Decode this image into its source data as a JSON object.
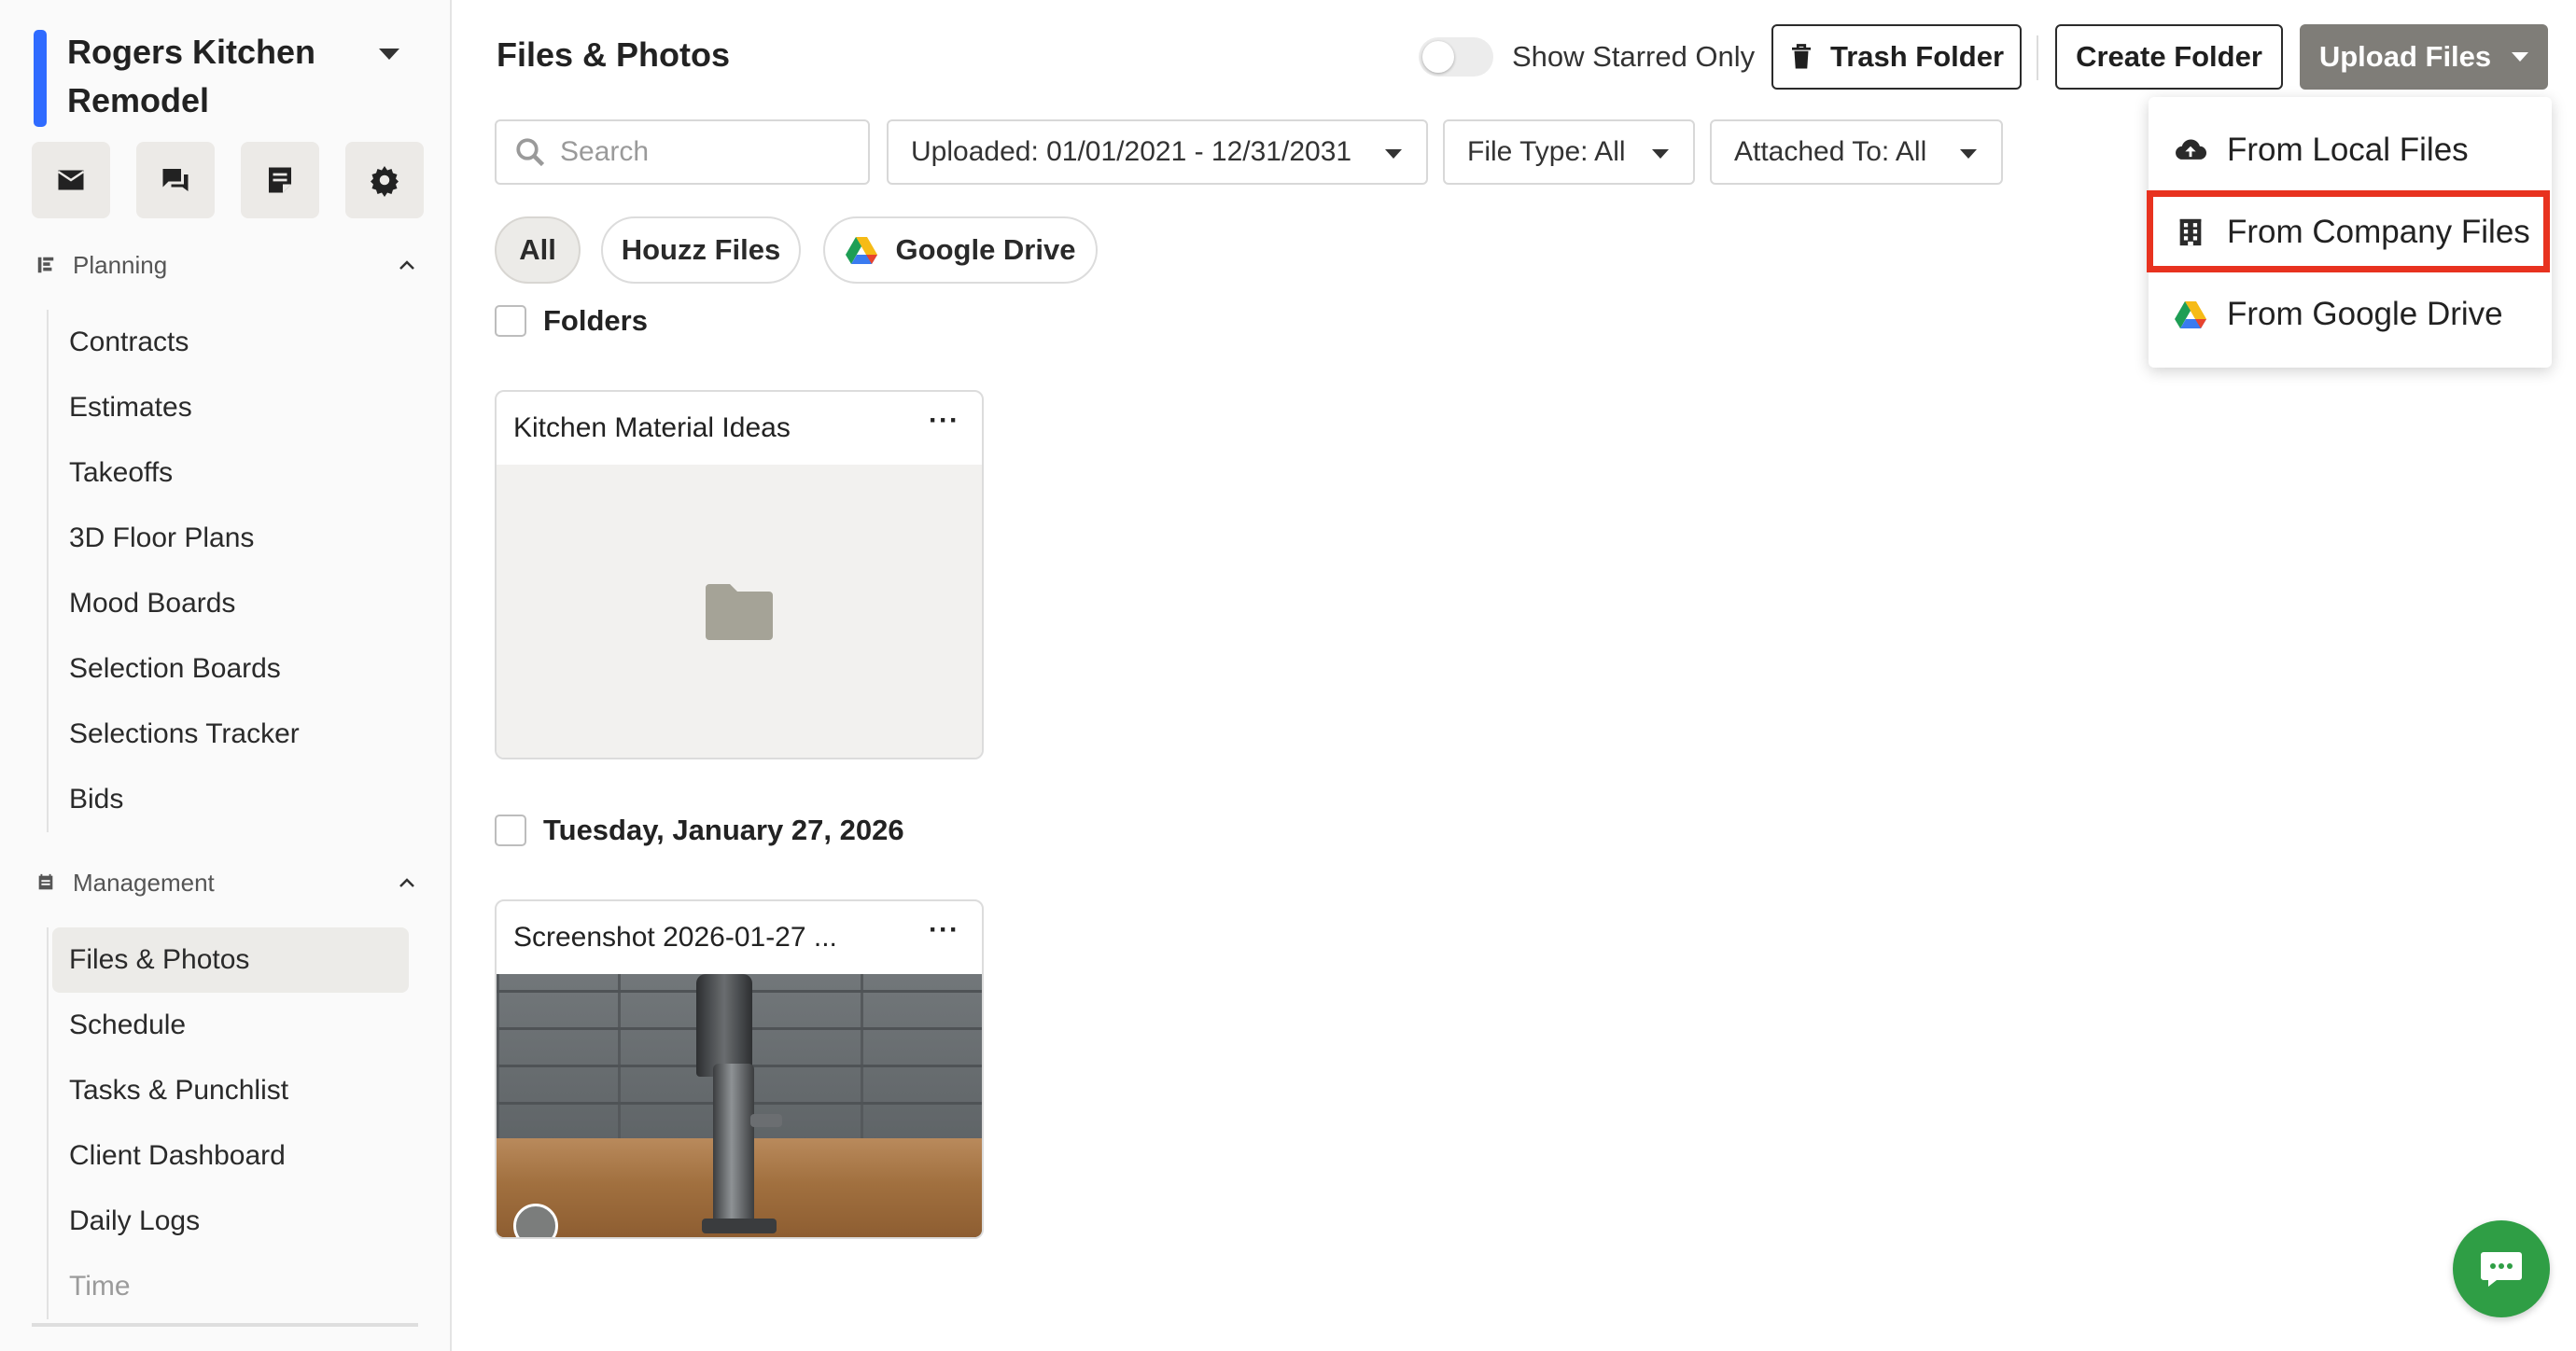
{
  "project": {
    "name": "Rogers Kitchen Remodel",
    "accent_color": "#2f6bff"
  },
  "quick_actions": [
    {
      "icon": "mail-icon"
    },
    {
      "icon": "chat-bubbles-icon"
    },
    {
      "icon": "notes-icon"
    },
    {
      "icon": "gear-icon"
    }
  ],
  "sidebar": {
    "planning": {
      "label": "Planning",
      "items": [
        "Contracts",
        "Estimates",
        "Takeoffs",
        "3D Floor Plans",
        "Mood Boards",
        "Selection Boards",
        "Selections Tracker",
        "Bids"
      ]
    },
    "management": {
      "label": "Management",
      "items": [
        "Files & Photos",
        "Schedule",
        "Tasks & Punchlist",
        "Client Dashboard",
        "Daily Logs",
        "Time"
      ],
      "active": "Files & Photos"
    }
  },
  "header": {
    "title": "Files & Photos",
    "toggle_label": "Show Starred Only",
    "trash_button": "Trash Folder",
    "create_button": "Create Folder",
    "upload_button": "Upload Files"
  },
  "filters": {
    "search_placeholder": "Search",
    "uploaded": "Uploaded: 01/01/2021 - 12/31/2031",
    "file_type": "File Type: All",
    "attached_to": "Attached To: All"
  },
  "chips": {
    "all": "All",
    "houzz": "Houzz Files",
    "gdrive": "Google Drive"
  },
  "folders_label": "Folders",
  "folder_card": {
    "title": "Kitchen Material Ideas"
  },
  "date_group": "Tuesday, January 27, 2026",
  "file_card": {
    "title": "Screenshot 2026-01-27 ..."
  },
  "upload_menu": {
    "local": "From Local Files",
    "company": "From Company Files",
    "gdrive": "From Google Drive"
  },
  "colors": {
    "upload_button": "#7f7d78",
    "highlight": "#e8321f",
    "chat": "#2f9e45"
  }
}
